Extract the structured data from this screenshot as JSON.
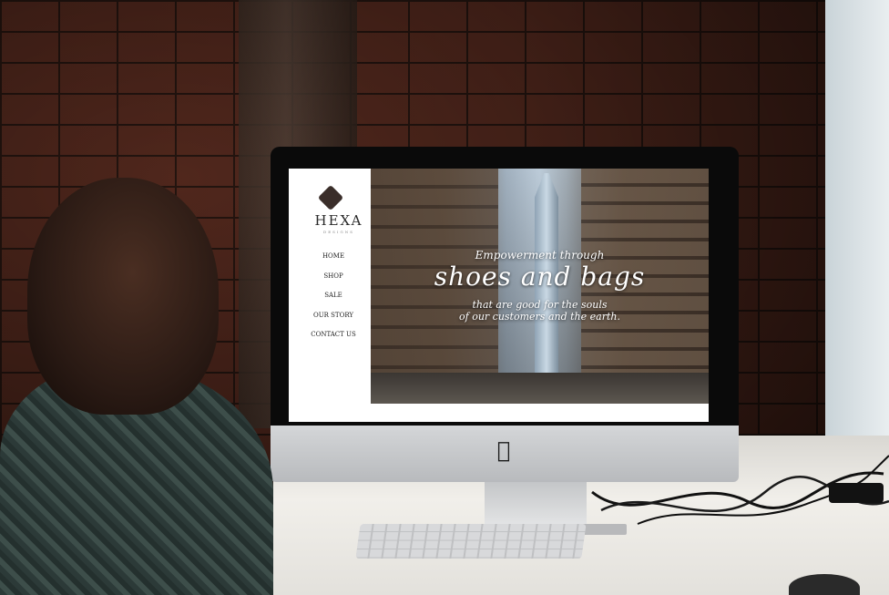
{
  "website": {
    "logo": {
      "name": "HEXA",
      "tagline": "DESIGNS"
    },
    "nav": [
      {
        "label": "HOME"
      },
      {
        "label": "SHOP"
      },
      {
        "label": "SALE"
      },
      {
        "label": "OUR STORY"
      },
      {
        "label": "CONTACT US"
      }
    ],
    "hero": {
      "pre": "Empowerment through",
      "main": "shoes and bags",
      "sub_line1": "that are good for the souls",
      "sub_line2": "of our customers and the earth."
    }
  },
  "device": {
    "logo_icon": "apple-logo-icon"
  },
  "colors": {
    "brick": "#6b3426",
    "bezel": "#0a0a0a",
    "chin": "#d4d6d8",
    "screen_bg": "#ffffff"
  }
}
